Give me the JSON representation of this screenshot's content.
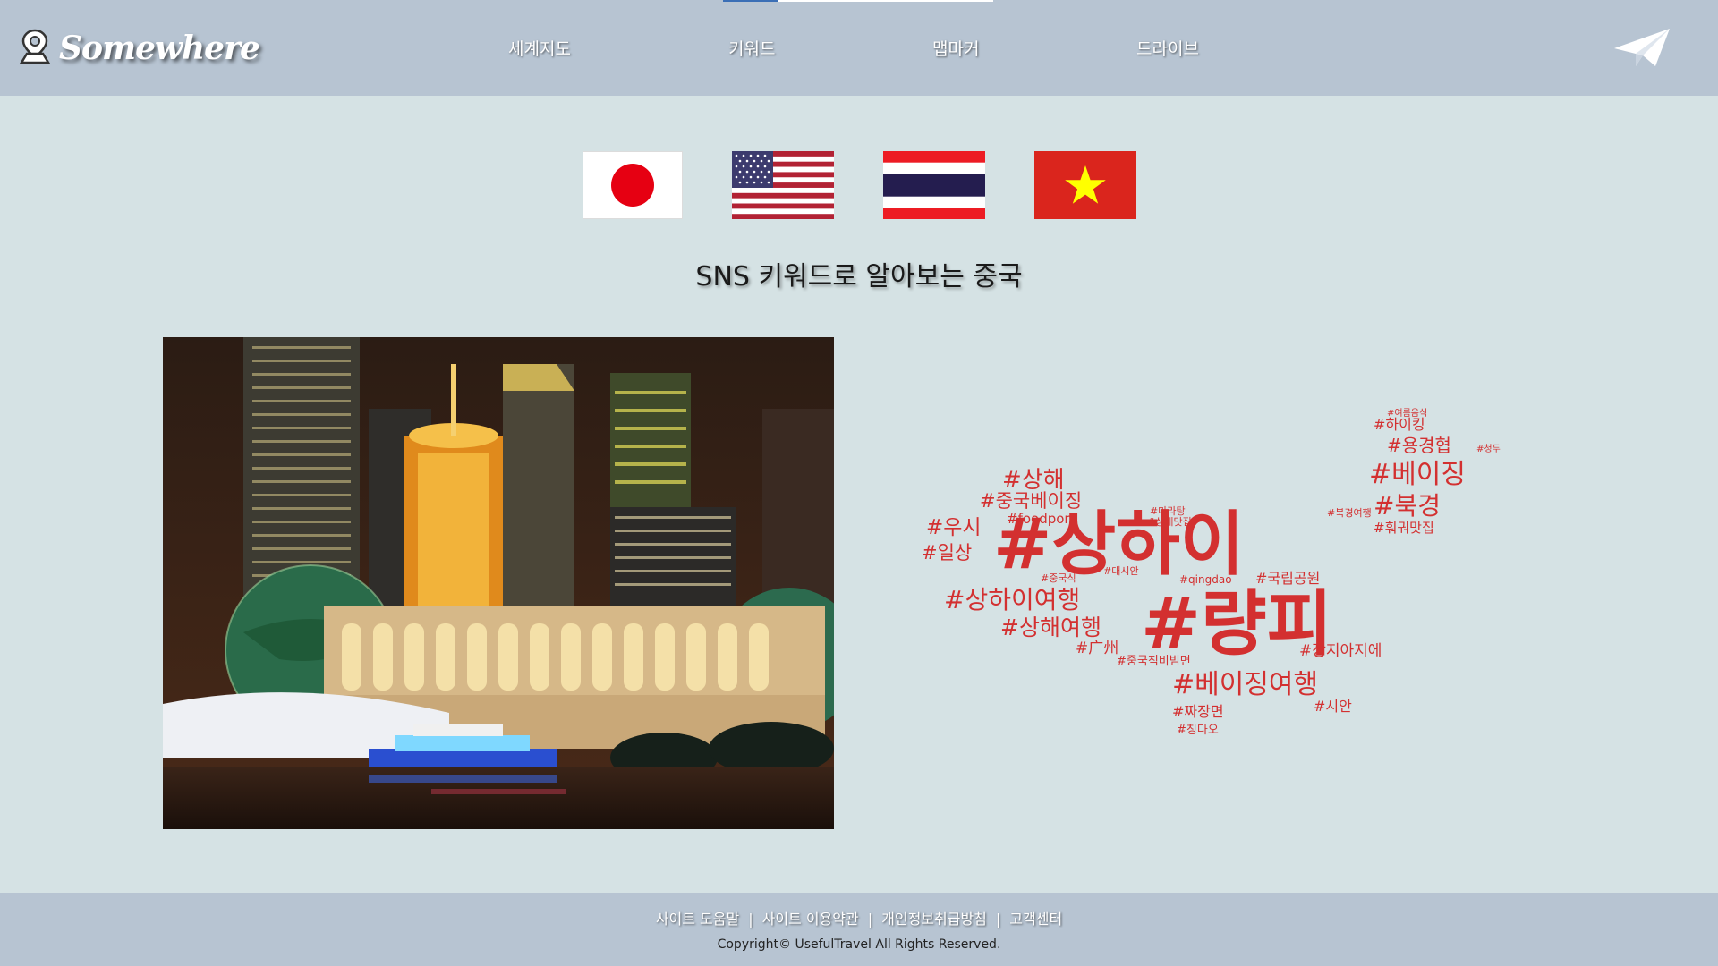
{
  "header": {
    "logo_text": "Somewhere",
    "logo_icon": "map-pin-icon",
    "nav": [
      {
        "label": "세계지도"
      },
      {
        "label": "키워드"
      },
      {
        "label": "맵마커"
      },
      {
        "label": "드라이브"
      }
    ],
    "send_icon": "paper-plane-icon"
  },
  "flags": [
    {
      "country": "japan",
      "icon": "flag-japan-icon"
    },
    {
      "country": "usa",
      "icon": "flag-usa-icon"
    },
    {
      "country": "thailand",
      "icon": "flag-thailand-icon"
    },
    {
      "country": "vietnam",
      "icon": "flag-vietnam-icon"
    }
  ],
  "main": {
    "headline": "SNS 키워드로 알아보는 중국",
    "wordcloud": {
      "color": "#d33030",
      "words": [
        "#상하이",
        "#량피",
        "#베이징여행",
        "#상하이여행",
        "#상해여행",
        "#상해",
        "#베이징",
        "#북경",
        "#용경협",
        "#하이킹",
        "#중국베이징",
        "#우시",
        "#일상",
        "#foodporn",
        "#국립공원",
        "#장지아지에",
        "#짜장면",
        "#칭다오",
        "#시안",
        "#중국직비빔면",
        "#广州",
        "#qingdao",
        "#훠궈맛집",
        "#여름음식",
        "#청두",
        "#중국식",
        "#대시안",
        "#마라탕",
        "#상해맛집",
        "#북경여행"
      ]
    }
  },
  "footer": {
    "links": [
      {
        "label": "사이트 도움말"
      },
      {
        "label": "사이트 이용약관"
      },
      {
        "label": "개인정보취급방침"
      },
      {
        "label": "고객센터"
      }
    ],
    "copyright": "Copyright© UsefulTravel All Rights Reserved."
  },
  "colors": {
    "header_bg": "#b7c4d2",
    "body_bg": "#d5e2e4",
    "wordcloud_red": "#d33030"
  }
}
